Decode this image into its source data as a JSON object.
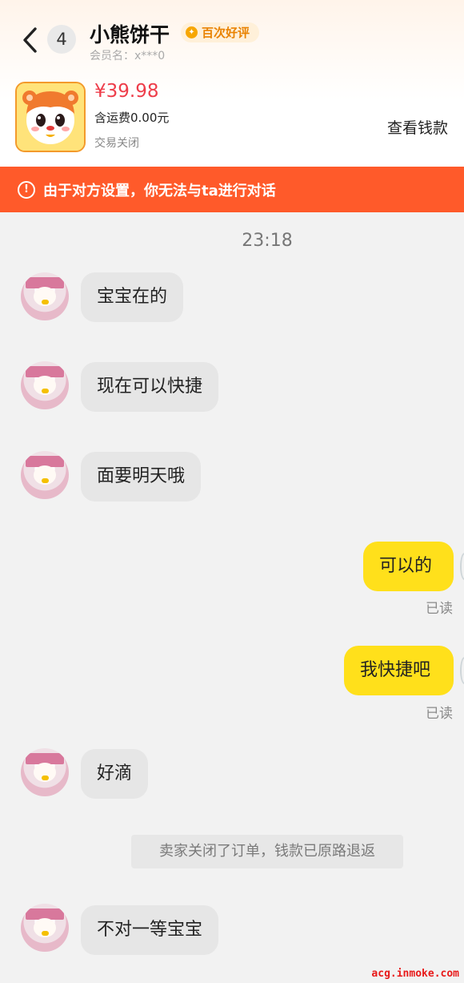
{
  "header": {
    "unread_count": "4",
    "shop_name": "小熊饼干",
    "review_badge": "百次好评",
    "member_name": "会员名：x***0",
    "price": "¥39.98",
    "shipping": "含运费0.00元",
    "trade_status": "交易关闭",
    "view_money_button": "查看钱款"
  },
  "warning": {
    "text": "由于对方设置，你无法与ta进行对话"
  },
  "chat": {
    "timestamp": "23:18",
    "messages": [
      {
        "side": "left",
        "text": "宝宝在的"
      },
      {
        "side": "left",
        "text": "现在可以快捷"
      },
      {
        "side": "left",
        "text": "面要明天哦"
      },
      {
        "side": "right",
        "text": "可以的",
        "status": "已读"
      },
      {
        "side": "right",
        "text": "我快捷吧",
        "status": "已读"
      },
      {
        "side": "left",
        "text": "好滴"
      },
      {
        "side": "left",
        "text": "不对一等宝宝"
      }
    ],
    "system_note": "卖家关闭了订单，钱款已原路退返"
  },
  "watermark": "acg.inmoke.com",
  "colors": {
    "accent_warning": "#ff5a2a",
    "price": "#ee3d4a",
    "my_bubble": "#ffe01b",
    "their_bubble": "#e6e6e6"
  },
  "icons": [
    "back-arrow-icon",
    "review-medal-icon",
    "warning-circle-icon",
    "seller-avatar-icon",
    "product-bear-icon"
  ]
}
